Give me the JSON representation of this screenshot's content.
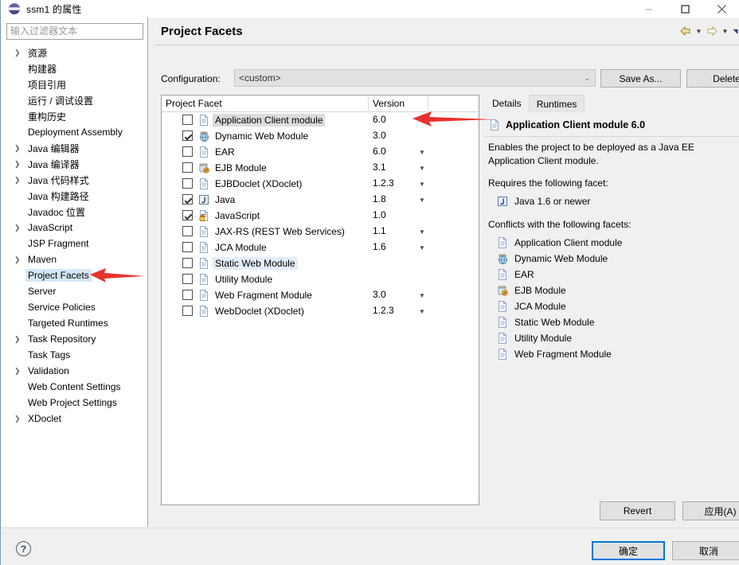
{
  "window": {
    "title": "ssm1 的属性",
    "icon": "eclipse-ball-icon",
    "minimize": "minimize-icon",
    "maximize": "maximize-icon",
    "close": "close-icon"
  },
  "sidebar": {
    "filter_placeholder": "输入过滤器文本",
    "filter_value": "",
    "items": [
      {
        "label": "资源",
        "expandable": true
      },
      {
        "label": "构建器",
        "expandable": false
      },
      {
        "label": "项目引用",
        "expandable": false
      },
      {
        "label": "运行 / 调试设置",
        "expandable": false
      },
      {
        "label": "重构历史",
        "expandable": false
      },
      {
        "label": "Deployment Assembly",
        "expandable": false
      },
      {
        "label": "Java 编辑器",
        "expandable": true
      },
      {
        "label": "Java 编译器",
        "expandable": true
      },
      {
        "label": "Java 代码样式",
        "expandable": true
      },
      {
        "label": "Java 构建路径",
        "expandable": false
      },
      {
        "label": "Javadoc 位置",
        "expandable": false
      },
      {
        "label": "JavaScript",
        "expandable": true
      },
      {
        "label": "JSP Fragment",
        "expandable": false
      },
      {
        "label": "Maven",
        "expandable": true
      },
      {
        "label": "Project Facets",
        "expandable": false,
        "selected": true
      },
      {
        "label": "Server",
        "expandable": false
      },
      {
        "label": "Service Policies",
        "expandable": false
      },
      {
        "label": "Targeted Runtimes",
        "expandable": false
      },
      {
        "label": "Task Repository",
        "expandable": true
      },
      {
        "label": "Task Tags",
        "expandable": false
      },
      {
        "label": "Validation",
        "expandable": true
      },
      {
        "label": "Web Content Settings",
        "expandable": false
      },
      {
        "label": "Web Project Settings",
        "expandable": false
      },
      {
        "label": "XDoclet",
        "expandable": true
      }
    ]
  },
  "page": {
    "title": "Project Facets",
    "nav_back": "back-arrow-icon",
    "nav_forward": "forward-arrow-icon",
    "nav_menu": "chevron-down-icon"
  },
  "configuration": {
    "label": "Configuration:",
    "value": "<custom>",
    "save_as_label": "Save As...",
    "delete_label": "Delete"
  },
  "facet_table": {
    "columns": [
      "Project Facet",
      "Version"
    ],
    "rows": [
      {
        "name": "Application Client module",
        "version": "6.0",
        "checked": false,
        "has_caret": true,
        "icon": "document-icon",
        "state": "selected"
      },
      {
        "name": "Dynamic Web Module",
        "version": "3.0",
        "checked": true,
        "has_caret": false,
        "icon": "web-module-icon",
        "state": ""
      },
      {
        "name": "EAR",
        "version": "6.0",
        "checked": false,
        "has_caret": true,
        "icon": "document-icon",
        "state": ""
      },
      {
        "name": "EJB Module",
        "version": "3.1",
        "checked": false,
        "has_caret": true,
        "icon": "ejb-module-icon",
        "state": ""
      },
      {
        "name": "EJBDoclet (XDoclet)",
        "version": "1.2.3",
        "checked": false,
        "has_caret": true,
        "icon": "document-icon",
        "state": ""
      },
      {
        "name": "Java",
        "version": "1.8",
        "checked": true,
        "has_caret": true,
        "icon": "java-icon",
        "state": ""
      },
      {
        "name": "JavaScript",
        "version": "1.0",
        "checked": true,
        "has_caret": false,
        "icon": "javascript-icon",
        "state": ""
      },
      {
        "name": "JAX-RS (REST Web Services)",
        "version": "1.1",
        "checked": false,
        "has_caret": true,
        "icon": "document-icon",
        "state": ""
      },
      {
        "name": "JCA Module",
        "version": "1.6",
        "checked": false,
        "has_caret": true,
        "icon": "document-icon",
        "state": ""
      },
      {
        "name": "Static Web Module",
        "version": "",
        "checked": false,
        "has_caret": false,
        "icon": "document-icon",
        "state": "highlight"
      },
      {
        "name": "Utility Module",
        "version": "",
        "checked": false,
        "has_caret": false,
        "icon": "document-icon",
        "state": ""
      },
      {
        "name": "Web Fragment Module",
        "version": "3.0",
        "checked": false,
        "has_caret": true,
        "icon": "document-icon",
        "state": ""
      },
      {
        "name": "WebDoclet (XDoclet)",
        "version": "1.2.3",
        "checked": false,
        "has_caret": true,
        "icon": "document-icon",
        "state": ""
      }
    ]
  },
  "details": {
    "tabs": [
      {
        "label": "Details",
        "active": true
      },
      {
        "label": "Runtimes",
        "active": false
      }
    ],
    "heading": "Application Client module 6.0",
    "heading_icon": "document-icon",
    "description": "Enables the project to be deployed as a Java EE Application Client module.",
    "requires_label": "Requires the following facet:",
    "requires": [
      {
        "label": "Java 1.6 or newer",
        "icon": "java-icon"
      }
    ],
    "conflicts_label": "Conflicts with the following facets:",
    "conflicts": [
      {
        "label": "Application Client module",
        "icon": "document-icon"
      },
      {
        "label": "Dynamic Web Module",
        "icon": "web-module-icon"
      },
      {
        "label": "EAR",
        "icon": "document-icon"
      },
      {
        "label": "EJB Module",
        "icon": "ejb-module-icon"
      },
      {
        "label": "JCA Module",
        "icon": "document-icon"
      },
      {
        "label": "Static Web Module",
        "icon": "document-icon"
      },
      {
        "label": "Utility Module",
        "icon": "document-icon"
      },
      {
        "label": "Web Fragment Module",
        "icon": "document-icon"
      }
    ]
  },
  "buttons": {
    "revert": "Revert",
    "apply": "应用(A)",
    "ok": "确定",
    "cancel": "取消",
    "help": "?"
  },
  "colors": {
    "selection_blue": "#0078d7",
    "highlight_row": "#e3eefb",
    "annotation_red": "#e8312a",
    "dialog_bg": "#f0f0f0"
  }
}
